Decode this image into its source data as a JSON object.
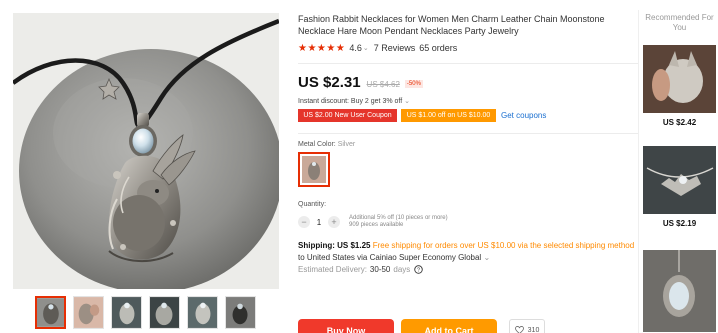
{
  "product": {
    "title": "Fashion Rabbit Necklaces for Women Men Charm Leather Chain Moonstone Necklace Hare Moon Pendant Necklaces Party Jewelry",
    "stars": "★★★★★",
    "rating": "4.6",
    "reviews": "7 Reviews",
    "orders": "65 orders"
  },
  "pricing": {
    "price": "US $2.31",
    "original_price": "US $4.62",
    "discount": "-50%",
    "instant_discount": "Instant discount: Buy 2 get 3% off",
    "coupons": [
      "US $2.00 New User Coupon",
      "US $1.00 off on US $10.00"
    ],
    "get_coupons": "Get coupons"
  },
  "variant": {
    "label": "Metal Color:",
    "selected": "Silver"
  },
  "quantity": {
    "label": "Quantity:",
    "minus": "−",
    "value": "1",
    "plus": "+",
    "note_line1": "Additional 5% off (10 pieces or more)",
    "note_line2": "909 pieces available"
  },
  "shipping": {
    "label": "Shipping:",
    "price": "US $1.25",
    "free_note": "Free shipping for orders over US $10.00 via the selected shipping method",
    "method": "to United States via Cainiao Super Economy Global",
    "delivery_label": "Estimated Delivery:",
    "delivery_days": "30-50",
    "delivery_unit": "days"
  },
  "actions": {
    "buy_now": "Buy Now",
    "add_to_cart": "Add to Cart",
    "wishlist_count": "310"
  },
  "recommended": {
    "header": "Recommended For You",
    "items": [
      {
        "price": "US $2.42"
      },
      {
        "price": "US $2.19"
      },
      {
        "price": ""
      }
    ]
  },
  "colors": {
    "accent_red": "#e62e04",
    "coupon_red": "#e5352b",
    "coupon_orange": "#ff9900",
    "link_blue": "#1a6fd0",
    "free_shipping_orange": "#ff8a00"
  },
  "icons": {
    "wishlist": "heart-icon",
    "help": "question-circle-icon",
    "dropdown": "chevron-down-icon"
  }
}
